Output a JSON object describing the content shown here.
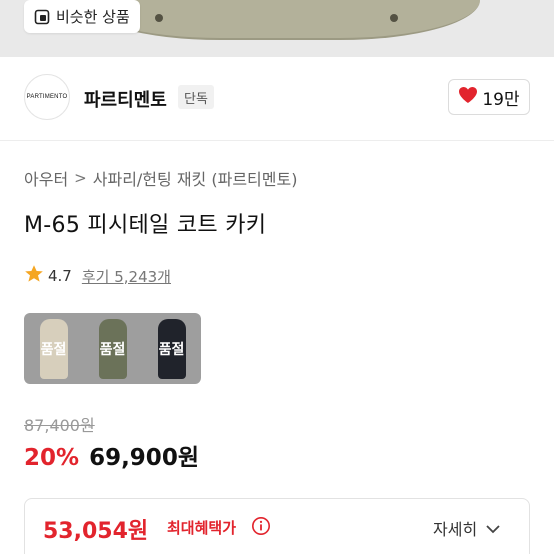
{
  "top_image": {
    "similar_button_label": "비슷한 상품",
    "similar_icon": "similar-items-icon"
  },
  "brand": {
    "logo_text": "PARTIMENTO",
    "name": "파르티멘토",
    "tag": "단독",
    "likes": "19만",
    "like_icon": "heart-icon",
    "heart_color": "#e2242d"
  },
  "breadcrumb": {
    "category": "아우터",
    "separator": ">",
    "subcategory": "사파리/헌팅 재킷 (파르티멘토)"
  },
  "product": {
    "title": "M-65 피시테일 코트 카키"
  },
  "rating": {
    "star_icon": "star-icon",
    "value": "4.7",
    "reviews_label": "후기 5,243개"
  },
  "swatches": [
    {
      "label": "품절",
      "color": "#d7cfbc"
    },
    {
      "label": "품절",
      "color": "#6b7259"
    },
    {
      "label": "품절",
      "color": "#20232b"
    }
  ],
  "price": {
    "original": "87,400원",
    "discount": "20%",
    "sale": "69,900원",
    "accent_color": "#e2242d"
  },
  "benefit": {
    "price": "53,054원",
    "label": "최대혜택가",
    "info_icon": "info-icon",
    "detail_label": "자세히",
    "chevron_icon": "chevron-down-icon"
  }
}
